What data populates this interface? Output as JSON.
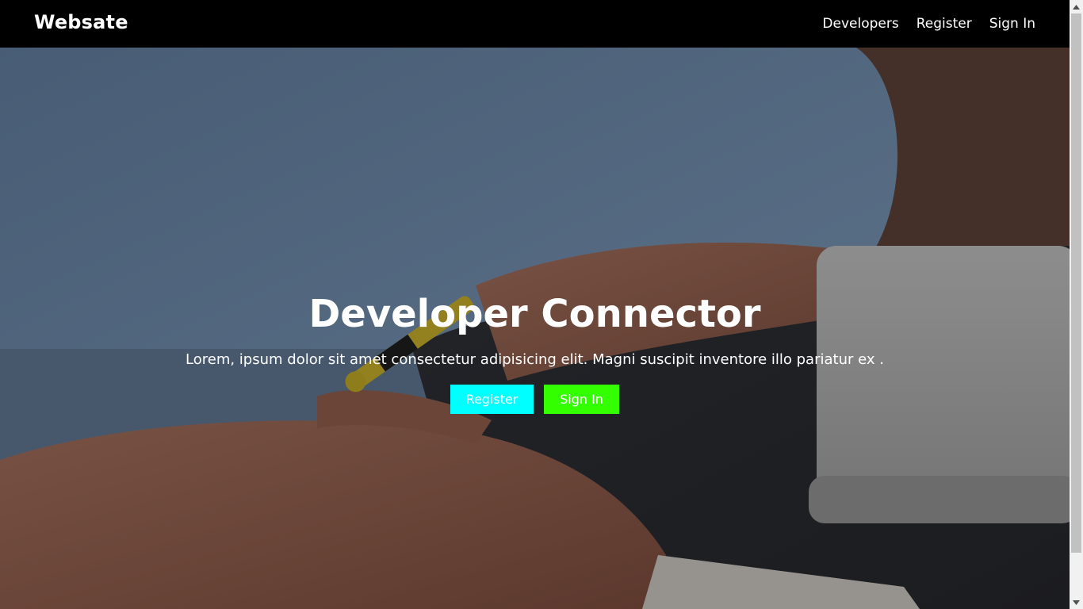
{
  "navbar": {
    "brand": "Websate",
    "links": [
      {
        "label": "Developers"
      },
      {
        "label": "Register"
      },
      {
        "label": "Sign In"
      }
    ]
  },
  "hero": {
    "title": "Developer Connector",
    "subtitle": "Lorem, ipsum dolor sit amet consectetur adipisicing elit. Magni suscipit inventore illo pariatur ex .",
    "buttons": {
      "register_label": "Register",
      "signin_label": "Sign In"
    },
    "background_image": "person-writing-with-yellow-pen"
  },
  "colors": {
    "navbar_bg": "#000000",
    "register_button": "#00ffff",
    "signin_button": "#33ff00",
    "text": "#ffffff"
  },
  "icons": {
    "scroll_up": "arrow-up-icon",
    "scroll_down": "arrow-down-icon"
  }
}
